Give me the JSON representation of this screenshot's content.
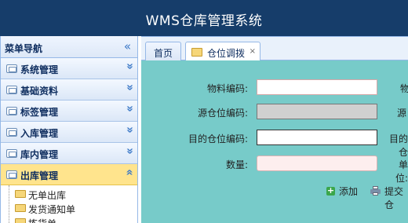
{
  "app": {
    "title": "WMS仓库管理系统"
  },
  "sidebar": {
    "header": "菜单导航",
    "sections": [
      {
        "label": "系统管理",
        "expanded": false
      },
      {
        "label": "基础资料",
        "expanded": false
      },
      {
        "label": "标签管理",
        "expanded": false
      },
      {
        "label": "入库管理",
        "expanded": false
      },
      {
        "label": "库内管理",
        "expanded": false
      },
      {
        "label": "出库管理",
        "expanded": true
      }
    ],
    "sub_items": [
      {
        "label": "无单出库"
      },
      {
        "label": "发货通知单"
      },
      {
        "label": "拣货单"
      }
    ]
  },
  "tabs": [
    {
      "label": "首页",
      "active": false
    },
    {
      "label": "仓位调拨",
      "active": true,
      "close": "×"
    }
  ],
  "form": {
    "fields": [
      {
        "label": "物料编码:",
        "value": ""
      },
      {
        "label": "源仓位编码:",
        "value": ""
      },
      {
        "label": "目的仓位编码:",
        "value": ""
      },
      {
        "label": "数量:",
        "value": ""
      }
    ],
    "right_labels": [
      "物",
      "源",
      "目的仓",
      "单位:"
    ],
    "actions": {
      "add": "添加",
      "submit": "提交仓"
    }
  },
  "colors": {
    "header_bg": "#163d6a",
    "panel_bg": "#77cbc9",
    "active_section": "#ffe48d"
  }
}
